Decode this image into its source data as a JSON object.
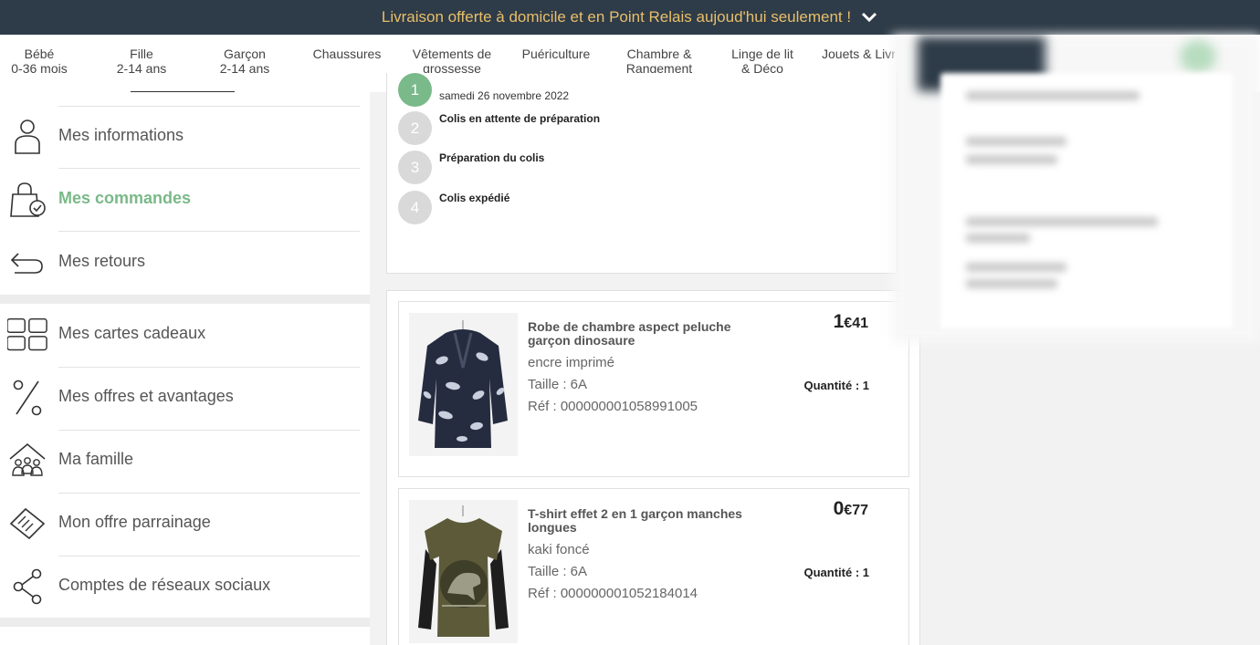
{
  "banner": {
    "text": "Livraison offerte à domicile et en Point Relais aujoud'hui seulement !",
    "chevron_icon": "chevron-down-icon"
  },
  "nav": [
    {
      "l1": "Bébé",
      "l2": "0-36 mois"
    },
    {
      "l1": "Fille",
      "l2": "2-14 ans"
    },
    {
      "l1": "Garçon",
      "l2": "2-14 ans"
    },
    {
      "l1": "Chaussures",
      "l2": ""
    },
    {
      "l1": "Vêtements de",
      "l2": "grossesse"
    },
    {
      "l1": "Puériculture",
      "l2": ""
    },
    {
      "l1": "Chambre &",
      "l2": "Rangement"
    },
    {
      "l1": "Linge de lit",
      "l2": "& Déco"
    },
    {
      "l1": "Jouets & Livr",
      "l2": ""
    }
  ],
  "sidebar": {
    "items": [
      {
        "label": "Mes informations",
        "icon": "user-icon",
        "active": false
      },
      {
        "label": "Mes commandes",
        "icon": "bag-check-icon",
        "active": true
      },
      {
        "label": "Mes retours",
        "icon": "return-arrow-icon",
        "active": false
      },
      {
        "label": "Mes cartes cadeaux",
        "icon": "gift-cards-icon",
        "active": false
      },
      {
        "label": "Mes offres et avantages",
        "icon": "percent-icon",
        "active": false
      },
      {
        "label": "Ma famille",
        "icon": "family-house-icon",
        "active": false
      },
      {
        "label": "Mon offre parrainage",
        "icon": "handshake-icon",
        "active": false
      },
      {
        "label": "Comptes de réseaux sociaux",
        "icon": "share-icon",
        "active": false
      }
    ]
  },
  "tracking": {
    "date": "samedi 26 novembre 2022",
    "steps": [
      {
        "num": "1",
        "label": "",
        "done": true
      },
      {
        "num": "2",
        "label": "Colis en attente de préparation",
        "done": false
      },
      {
        "num": "3",
        "label": "Préparation du colis",
        "done": false
      },
      {
        "num": "4",
        "label": "Colis expédié",
        "done": false
      }
    ]
  },
  "products": [
    {
      "name": "Robe de chambre aspect peluche garçon dinosaure",
      "color": "encre imprimé",
      "size": "Taille : 6A",
      "ref": "Réf : 000000001058991005",
      "price_int": "1",
      "price_dec": "€41",
      "qty": "Quantité : 1",
      "image_icon": "bathrobe-image"
    },
    {
      "name": "T-shirt effet 2 en 1 garçon manches longues",
      "color": "kaki foncé",
      "size": "Taille : 6A",
      "ref": "Réf : 000000001052184014",
      "price_int": "0",
      "price_dec": "€77",
      "qty": "Quantité : 1",
      "image_icon": "tshirt-image"
    }
  ],
  "colors": {
    "banner_bg": "#2e3b48",
    "banner_text": "#e8bf6a",
    "accent_green": "#7ab989"
  }
}
